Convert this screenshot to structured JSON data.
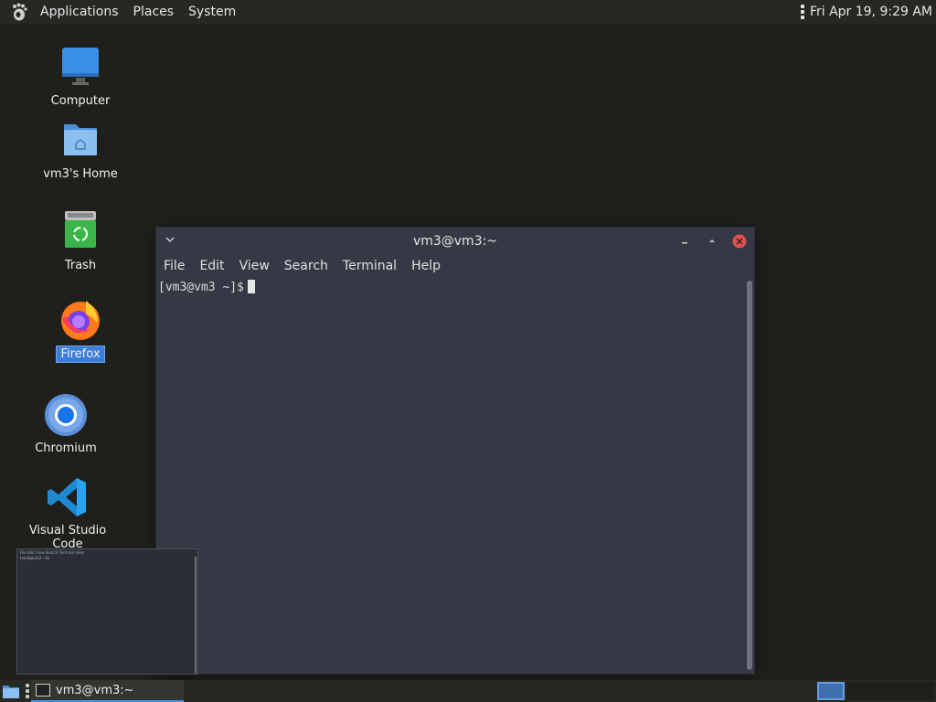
{
  "top_panel": {
    "menus": [
      "Applications",
      "Places",
      "System"
    ],
    "clock": "Fri Apr 19,  9:29 AM",
    "logo_icon": "gnome-foot-icon"
  },
  "desktop": {
    "icons": [
      {
        "label": "Computer",
        "icon": "computer-icon"
      },
      {
        "label": "vm3's Home",
        "icon": "home-folder-icon"
      },
      {
        "label": "Trash",
        "icon": "trash-icon"
      },
      {
        "label": "Firefox",
        "icon": "firefox-icon",
        "selected": true
      },
      {
        "label": "Chromium",
        "icon": "chromium-icon"
      },
      {
        "label": "Visual Studio Code",
        "icon": "vscode-icon"
      }
    ]
  },
  "terminal": {
    "title": "vm3@vm3:~",
    "menu": [
      "File",
      "Edit",
      "View",
      "Search",
      "Terminal",
      "Help"
    ],
    "prompt": "[vm3@vm3 ~]$"
  },
  "preview": {
    "menu_text": "File  Edit  View  Search  Terminal  Help",
    "prompt": "[vm3@vm3 ~]$"
  },
  "bottom_panel": {
    "task_label": "vm3@vm3:~"
  },
  "colors": {
    "desktop_bg": "#1f201c",
    "panel_bg": "#272824",
    "terminal_bg": "#353945",
    "accent": "#3d7ed8",
    "close_button": "#e0504a"
  }
}
